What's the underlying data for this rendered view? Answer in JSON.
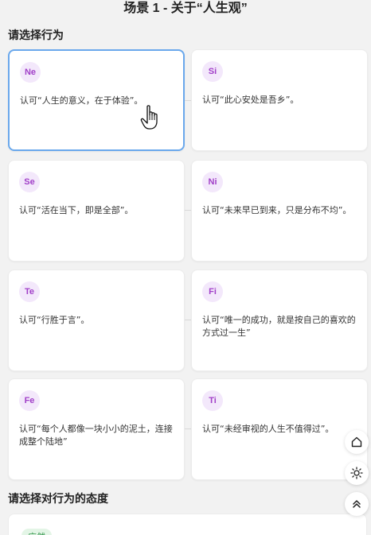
{
  "page": {
    "title": "场景 1 - 关于“人生观”"
  },
  "sections": {
    "behavior_label": "请选择行为",
    "attitude_label": "请选择对行为的态度"
  },
  "options": [
    {
      "code": "Ne",
      "text": "认可“人生的意义，在于体验”。",
      "selected": true
    },
    {
      "code": "Si",
      "text": "认可“此心安处是吾乡”。",
      "selected": false
    },
    {
      "code": "Se",
      "text": "认可“活在当下，即是全部”。",
      "selected": false
    },
    {
      "code": "Ni",
      "text": "认可“未来早已到来，只是分布不均”。",
      "selected": false
    },
    {
      "code": "Te",
      "text": "认可“行胜于言”。",
      "selected": false
    },
    {
      "code": "Fi",
      "text": "认可“唯一的成功，就是按自己的喜欢的方式过一生”",
      "selected": false
    },
    {
      "code": "Fe",
      "text": "认可“每个人都像一块小小的泥土，连接成整个陆地”",
      "selected": false
    },
    {
      "code": "Ti",
      "text": "认可“未经审视的人生不值得过”。",
      "selected": false
    }
  ],
  "attitude": {
    "first_tag": "应然"
  },
  "floating_buttons": [
    "home-icon",
    "sun-icon",
    "double-chevron-up-icon"
  ],
  "colors": {
    "background": "#f2f2f2",
    "badge_bg": "#f3e8fb",
    "badge_text": "#a140c8",
    "selected_border": "#6aa8ec",
    "tag_bg": "#e3f5e6",
    "tag_text": "#3a9a52"
  }
}
